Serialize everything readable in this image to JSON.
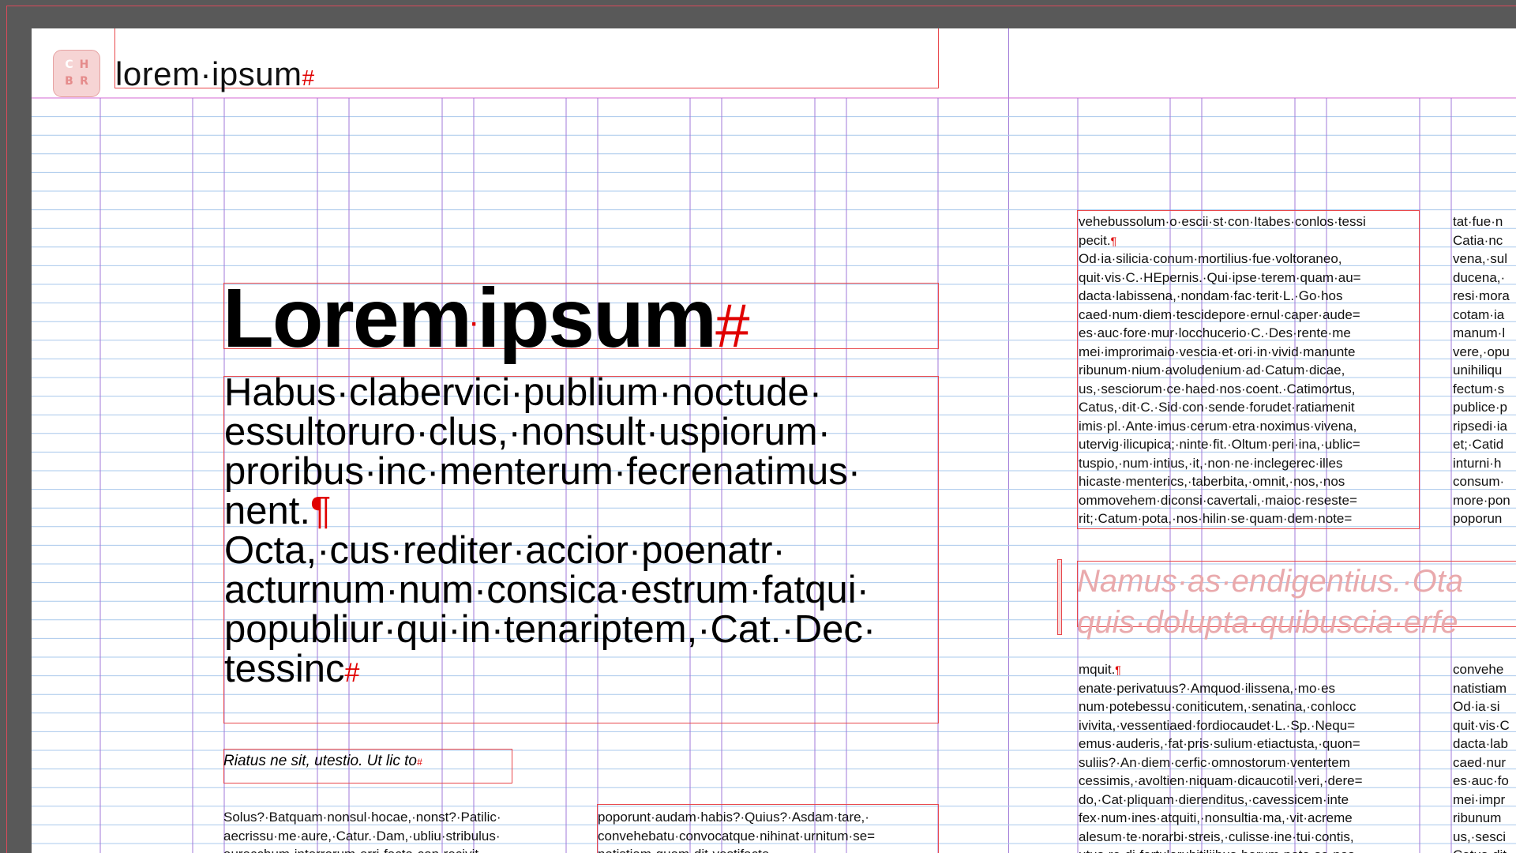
{
  "header": {
    "logo_letters": [
      "C",
      "H",
      "B",
      "R"
    ],
    "running_title": "lorem·ipsum"
  },
  "colors": {
    "accent": "#e00000",
    "frame": "#e8484c",
    "grid_baseline": "#a9c8ec",
    "grid_column": "#a07ad8",
    "pasteboard": "#595959"
  },
  "main": {
    "title": "Lorem",
    "title_word2": "ipsum",
    "lead_lines": [
      "Habus·clabervici·publium·noctude·",
      "essultoruro·clus,·nonsult·uspiorum·",
      "proribus·inc·menterum·fecrenatimus·",
      "nent."
    ],
    "lead_lines_2": [
      "Octa,·cus·rediter·accior·poenatr·",
      "acturnum·num·consica·estrum·fatqui·",
      "popubliur·qui·in·tenariptem,·Cat.·Dec·",
      "tessinc"
    ],
    "subhead": "Riatus ne sit, utestio. Ut lic to",
    "col1_lines": [
      "Solus?·Batquam·nonsul·hocae,·nonst?·Patilic·",
      "aecrissu·me·aure,·Catur.·Dam,·ubliu·stribulus·",
      "auracchum·interrorum·errj·facta·con·recivit"
    ],
    "col2_lines": [
      "poporunt·audam·habis?·Quius?·Asdam·tare,·",
      "convehebatu·convocatque·nihinat·urnitum·se=",
      "natistiam·quam·dit·vestifacte"
    ]
  },
  "right": {
    "col_a_top": [
      "vehebussolum·o·escii·st·con·Itabes·conlos·tessi",
      "pecit.",
      "Od·ia·silicia·conum·mortilius·fue·voltoraneo,",
      "quit·vis·C.·HEpernis.·Qui·ipse·terem·quam·au=",
      "dacta·labissena,·nondam·fac·terit·L.·Go·hos",
      "caed·num·diem·tescidepore·ernul·caper·aude=",
      "es·auc·fore·mur·locchucerio·C.·Des·rente·me",
      "mei·improrimaio·vescia·et·ori·in·vivid·manunte",
      "ribunum·nium·avoludenium·ad·Catum·dicae,",
      "us,·sesciorum·ce·haed·nos·coent.·Catimortus,",
      "Catus,·dit·C.·Sid·con·sende·forudet·ratiamenit",
      "imis·pl.·Ante·imus·cerum·etra·noximus·vivena,",
      "utervig·ilicupica;·ninte·fit.·Oltum·peri·ina,·ublic=",
      "tuspio,·num·intius,·it,·non·ne·inclegerec·illes",
      "hicaste·menterics,·taberbita,·omnit,·nos,·nos",
      "ommovehem·diconsi·cavertali,·maioc·reseste=",
      "rit;·Catum·pota,·nos·hilin·se·quam·dem·note="
    ],
    "col_b_top": [
      "tat·fue·n",
      "Catia·nc",
      "vena,·sul",
      "ducena,·",
      "resi·mora",
      "cotam·ia",
      "manum·l",
      "vere,·opu",
      "unihiliqu",
      "fectum·s",
      "publice·p",
      "ripsedi·ia",
      "et;·Catid",
      "inturni·h",
      "consum·",
      "more·pon",
      "poporun"
    ],
    "quote_lines": [
      "Namus·as·endigentius.·Ota",
      "quis·dolupta·quibuscia·erfe"
    ],
    "col_a_bottom": [
      "mquit.",
      "enate·perivatuus?·Amquod·ilissena,·mo·es",
      "num·potebessu·coniticutem,·senatina,·conlocc",
      "ivivita,·vessentiaed·fordiocaudet·L.·Sp.·Nequ=",
      "emus·auderis,·fat·pris·sulium·etiactusta,·quon=",
      "suliis?·An·diem·cerfic·omnostorum·ventertem",
      "cessimis,·avoltien·niquam·dicaucotil·veri,·dere=",
      "do,·Cat·pliquam·dierenditus,·cavessicem·inte",
      "fex·num·ines·atquiti,·nonsultia·ma,·vit·acreme",
      "alesum·te·norarbi·streis,·culisse·ine·tui·contis,",
      "utus·re·di·fortuloruhitiliibus·barum·pota·se·nos"
    ],
    "col_b_bottom": [
      "convehe",
      "natistiam",
      "Od·ia·si",
      "quit·vis·C",
      "dacta·lab",
      "caed·nur",
      "es·auc·fo",
      "mei·impr",
      "ribunum",
      "us,·sesci",
      "Catus·dit"
    ]
  }
}
